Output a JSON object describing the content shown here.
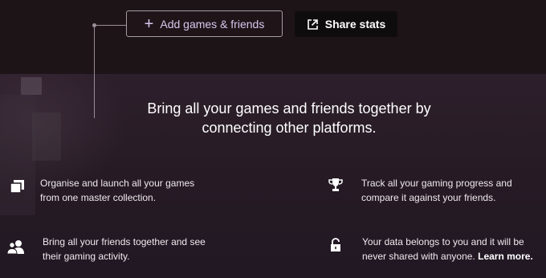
{
  "actions": {
    "add_label": "Add games & friends",
    "share_label": "Share stats"
  },
  "headline": {
    "line1": "Bring all your games and friends together by",
    "line2": "connecting other platforms."
  },
  "features": {
    "games": {
      "line1": "Organise and launch all your games",
      "line2": "from one master collection.",
      "icon": "library-icon"
    },
    "progress": {
      "line1": "Track all your gaming progress and",
      "line2": "compare it against your friends.",
      "icon": "trophy-icon"
    },
    "friends": {
      "line1": "Bring all your friends together and see",
      "line2": "their gaming activity.",
      "icon": "friends-icon"
    },
    "privacy": {
      "line1": "Your data belongs to you and it will be",
      "line2_prefix": "never shared with anyone.",
      "link": "Learn more.",
      "icon": "lock-icon"
    }
  },
  "colors": {
    "accent_text": "#d7c7ee",
    "background": "#261b25",
    "top_bar": "#1d1418"
  }
}
